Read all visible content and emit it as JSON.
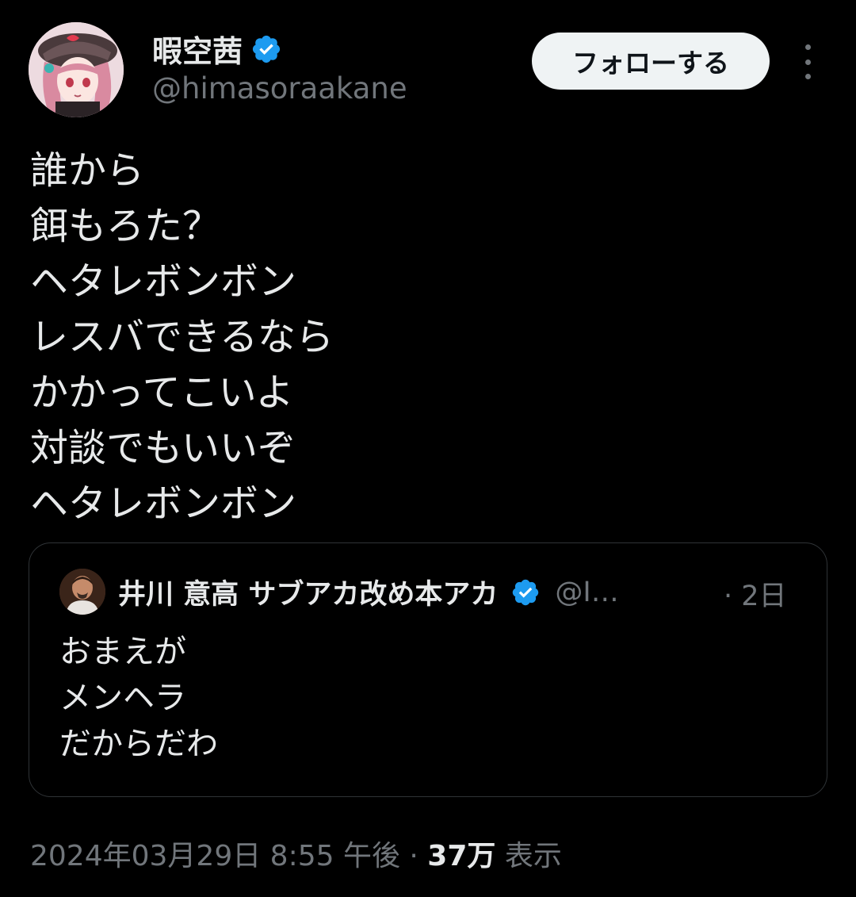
{
  "author": {
    "display_name": "暇空茜",
    "handle": "@himasoraakane",
    "verified": true
  },
  "follow_button_label": "フォローする",
  "tweet_lines": [
    "誰から",
    "餌もろた？",
    "ヘタレボンボン",
    "レスバできるなら",
    "かかってこいよ",
    "対談でもいいぞ",
    "ヘタレボンボン"
  ],
  "quoted_tweet": {
    "display_name": "井川 意高 サブアカ改め本アカ",
    "handle": "@I…",
    "time": "· 2日",
    "verified": true,
    "lines": [
      "おまえが",
      "メンヘラ",
      "だからだわ"
    ]
  },
  "meta": {
    "timestamp": "2024年03月29日 8:55 午後 · ",
    "views_count": "37万",
    "views_label": " 表示"
  },
  "colors": {
    "background": "#000000",
    "text_primary": "#e7e9ea",
    "text_secondary": "#71767b",
    "verified_blue": "#1d9bf0",
    "border": "#2f3336",
    "follow_bg": "#eff3f4"
  }
}
